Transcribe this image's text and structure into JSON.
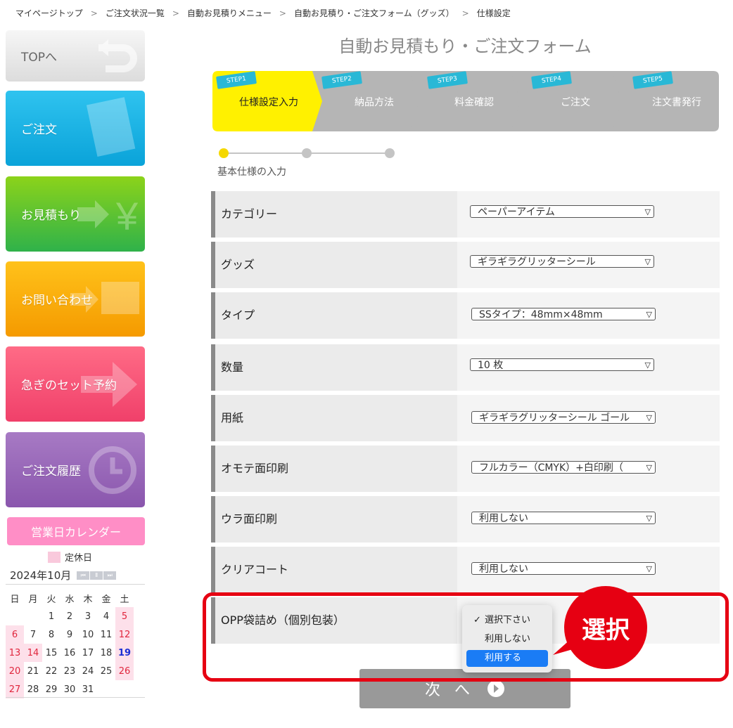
{
  "breadcrumb": [
    "マイページトップ",
    "ご注文状況一覧",
    "自動お見積りメニュー",
    "自動お見積り・ご注文フォーム（グッズ）",
    "仕様設定"
  ],
  "breadcrumb_sep": ">",
  "sidebar": {
    "top": "TOPへ",
    "order": "ご注文",
    "estimate": "お見積もり",
    "contact": "お問い合わせ",
    "rush": "急ぎのセット予約",
    "history": "ご注文履歴",
    "calendar_button": "営業日カレンダー",
    "legend": "定休日"
  },
  "calendar": {
    "month": "2024年10月",
    "weekdays": [
      "日",
      "月",
      "火",
      "水",
      "木",
      "金",
      "土"
    ],
    "weeks": [
      [
        "",
        "",
        "1",
        "2",
        "3",
        "4",
        "5"
      ],
      [
        "6",
        "7",
        "8",
        "9",
        "10",
        "11",
        "12"
      ],
      [
        "13",
        "14",
        "15",
        "16",
        "17",
        "18",
        "19"
      ],
      [
        "20",
        "21",
        "22",
        "23",
        "24",
        "25",
        "26"
      ],
      [
        "27",
        "28",
        "29",
        "30",
        "31",
        "",
        ""
      ]
    ],
    "holidays": [
      "5",
      "6",
      "12",
      "13",
      "14",
      "20",
      "26",
      "27"
    ],
    "blue_days": [
      "19"
    ]
  },
  "main": {
    "title": "自動お見積もり・ご注文フォーム",
    "steps": [
      {
        "tag": "STEP1",
        "label": "仕様設定入力"
      },
      {
        "tag": "STEP2",
        "label": "納品方法"
      },
      {
        "tag": "STEP3",
        "label": "料金確認"
      },
      {
        "tag": "STEP4",
        "label": "ご注文"
      },
      {
        "tag": "STEP5",
        "label": "注文書発行"
      }
    ],
    "sub_step_label": "基本仕様の入力",
    "rows": [
      {
        "label": "カテゴリー",
        "value": "ペーパーアイテム"
      },
      {
        "label": "グッズ",
        "value": "ギラギラグリッターシール"
      },
      {
        "label": "タイプ",
        "value": "SSタイプ：48mm×48mm"
      },
      {
        "label": "数量",
        "value": "10 枚"
      },
      {
        "label": "用紙",
        "value": "ギラギラグリッターシール ゴール"
      },
      {
        "label": "オモテ面印刷",
        "value": "フルカラー（CMYK）+白印刷（"
      },
      {
        "label": "ウラ面印刷",
        "value": "利用しない"
      },
      {
        "label": "クリアコート",
        "value": "利用しない"
      },
      {
        "label": "OPP袋詰め（個別包装）",
        "value": ""
      }
    ],
    "dropdown_options": [
      "選択下さい",
      "利用しない",
      "利用する"
    ],
    "callout": "選択",
    "next_button": "次へ"
  }
}
